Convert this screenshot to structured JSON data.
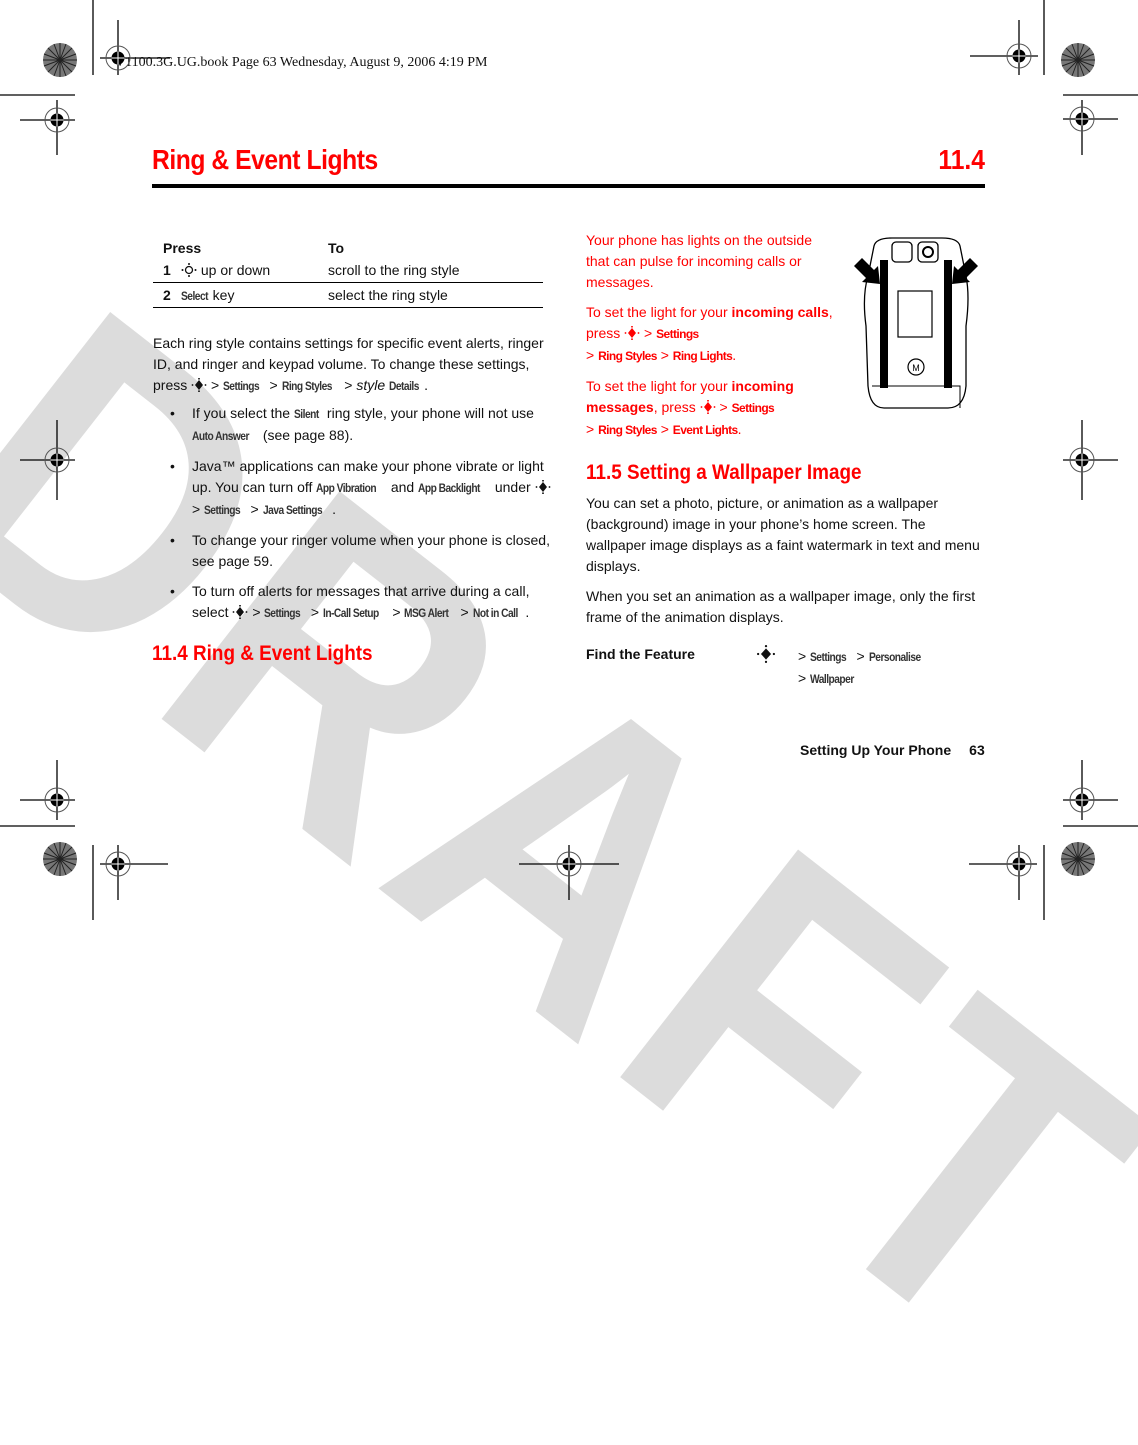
{
  "book_line": "V1100.3G.UG.book  Page 63  Wednesday, August 9, 2006  4:19 PM",
  "header": {
    "title": "Ring & Event Lights",
    "section_number": "11.4"
  },
  "watermark": "DRAFT",
  "table": {
    "headers": [
      "Press",
      "To"
    ],
    "rows": [
      {
        "step": "1",
        "press_suffix": " up or down",
        "to": "scroll to the ring style",
        "icon": "nav-key-icon"
      },
      {
        "step": "2",
        "press_menu": "Select",
        "press_suffix": " key",
        "to": "select the ring style"
      }
    ]
  },
  "left": {
    "para1_a": "Each ring style contains settings for specific event alerts, ringer ID, and ringer and keypad volume. To change these settings, press ",
    "para1_path": [
      "Settings",
      "Ring Styles"
    ],
    "para1_italic": "style",
    "para1_end": "Details",
    "bullets": [
      {
        "a": "If you select the ",
        "m1": "Silent",
        "b": " ring style, your phone will not use ",
        "m2": "Auto Answer",
        "c": " (see page 88)."
      },
      {
        "a": "Java™ applications can make your phone vibrate or light up. You can turn off ",
        "m1": "App Vibration",
        "b": " and ",
        "m2": "App Backlight",
        "c": " under ",
        "path": [
          "Settings",
          "Java Settings"
        ]
      },
      {
        "a": "To change your ringer volume when your phone is closed, see page 59."
      },
      {
        "a": "To turn off alerts for messages that arrive during a call, select ",
        "path": [
          "Settings",
          "In-Call Setup",
          "MSG Alert",
          "Not in Call"
        ]
      }
    ],
    "section_heading": "11.4 Ring & Event Lights"
  },
  "right": {
    "intro": "Your phone has lights on the outside that can pulse for incoming calls or messages.",
    "calls_a": "To set the light for your ",
    "calls_bold": "incoming calls",
    "calls_b": ", press ",
    "calls_path": [
      "Settings",
      "Ring Styles",
      "Ring Lights"
    ],
    "msgs_a": "To set the light for your ",
    "msgs_bold": "incoming messages",
    "msgs_b": ", press ",
    "msgs_path": [
      "Settings",
      "Ring Styles",
      "Event Lights"
    ],
    "section_heading": "11.5 Setting a Wallpaper Image",
    "wall_p1": "You can set a photo, picture, or animation as a wallpaper (background) image in your phone’s home screen. The wallpaper image displays as a faint watermark in text and menu displays.",
    "wall_p2": "When you set an animation as a wallpaper image, only the first frame of the animation displays.",
    "find_feature_label": "Find the Feature",
    "find_feature_path": [
      "Settings",
      "Personalise",
      "Wallpaper"
    ]
  },
  "footer": {
    "chapter": "Setting Up Your Phone",
    "page": "63"
  },
  "colors": {
    "accent": "#ff0000",
    "text": "#111111",
    "watermark": "#d9d9d9"
  }
}
